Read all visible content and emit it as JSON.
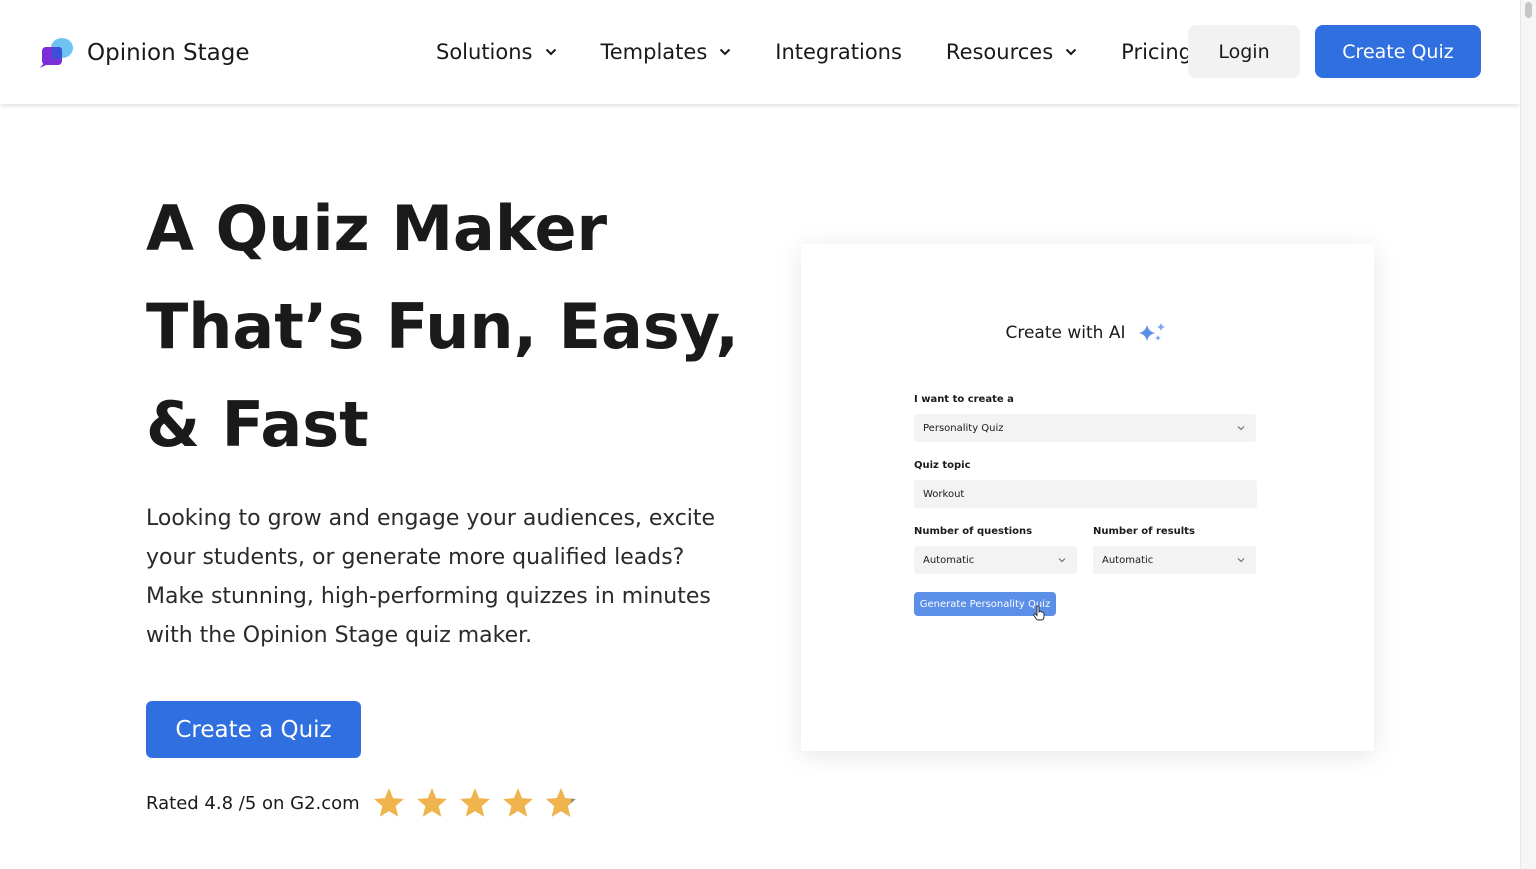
{
  "brand": {
    "name": "Opinion Stage",
    "icon": "chat-bubbles-logo-icon"
  },
  "nav": {
    "items": [
      {
        "label": "Solutions",
        "has_dropdown": true
      },
      {
        "label": "Templates",
        "has_dropdown": true
      },
      {
        "label": "Integrations",
        "has_dropdown": false
      },
      {
        "label": "Resources",
        "has_dropdown": true
      },
      {
        "label": "Pricing",
        "has_dropdown": false
      }
    ],
    "login_label": "Login",
    "create_label": "Create Quiz"
  },
  "hero": {
    "title_lines": [
      "A Quiz Maker",
      "That’s Fun, Easy,",
      "& Fast"
    ],
    "description": "Looking to grow and engage your audiences, excite your students, or generate more qualified leads? Make stunning, high-performing quizzes in minutes with the Opinion Stage quiz maker.",
    "cta_label": "Create a Quiz",
    "rating_text": "Rated 4.8 /5 on G2.com",
    "rating_value": 4.8,
    "rating_max": 5
  },
  "ai_card": {
    "title": "Create with AI",
    "icon": "sparkle-icon",
    "type_label": "I want to create a",
    "type_value": "Personality Quiz",
    "topic_label": "Quiz topic",
    "topic_value": "Workout",
    "questions_label": "Number of questions",
    "questions_value": "Automatic",
    "results_label": "Number of results",
    "results_value": "Automatic",
    "generate_label": "Generate Personality Quiz"
  },
  "colors": {
    "primary": "#2f6fe0",
    "star": "#f0b44c",
    "text": "#1a1a1a",
    "light_button": "#f2f2f2"
  }
}
